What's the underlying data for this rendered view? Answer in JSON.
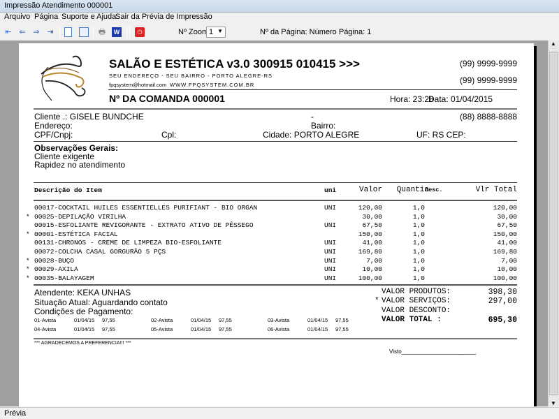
{
  "window": {
    "title": "Impressão Atendimento 000001"
  },
  "menu": [
    "Arquivo",
    "Página",
    "Suporte e Ajuda",
    "Sair da Prévia de Impressão"
  ],
  "toolbar": {
    "zoom_label": "Nº Zoom",
    "zoom_value": "1",
    "page_label": "Nº da Página: Número Página: 1",
    "icons": [
      "first-page-icon",
      "prev-page-icon",
      "next-page-icon",
      "last-page-icon",
      "single-page-icon",
      "two-page-icon",
      "print-icon",
      "word-export-icon",
      "close-preview-icon"
    ]
  },
  "report": {
    "company": "SALÃO E ESTÉTICA v3.0 300915 010415 >>>",
    "address": "SEU ENDEREÇO - SEU BAIRRO - PORTO ALEGRE-RS",
    "email": "fpqsystem@hotmail.com",
    "site": "WWW.FPQSYSTEM.COM.BR",
    "phone1": "(99) 9999-9999",
    "phone2": "(99) 9999-9999",
    "order": "Nº DA COMANDA 000001",
    "hora": "Hora: 23:28",
    "data": "Data: 01/04/2015",
    "cliente": "Cliente   .: GISELE BUNDCHE",
    "dash": "-",
    "cliente_phone": "(88) 8888-8888",
    "endereco": "Endereço:",
    "bairro": "Bairro:",
    "cpf": "CPF/Cnpj:",
    "cpl": "Cpl:",
    "cidade": "Cidade: PORTO ALEGRE",
    "uf": "UF: RS  CEP:",
    "obs_title": "Observações Gerais:",
    "obs1": "Cliente exigente",
    "obs2": "Rapidez no atendimento",
    "columns": {
      "desc": "Descrição do Item",
      "uni": "uni",
      "valor": "Valor",
      "quantia": "Quantia",
      "descv": "Desc.",
      "total": "Vlr Total"
    },
    "items": [
      {
        "star": "",
        "desc": "00017-COCKTAIL HUILES ESSENTIELLES PURIFIANT - BIO ORGAN",
        "uni": "UNI",
        "valor": "120,00",
        "qtd": "1,0",
        "total": "120,00"
      },
      {
        "star": "*",
        "desc": "00025-DEPILAÇÃO VIRILHA",
        "uni": "",
        "valor": "30,00",
        "qtd": "1,0",
        "total": "30,00"
      },
      {
        "star": "",
        "desc": "00015-ESFOLIANTE REVIGORANTE - EXTRATO ATIVO DE PÊSSEGO",
        "uni": "UNI",
        "valor": "67,50",
        "qtd": "1,0",
        "total": "67,50"
      },
      {
        "star": "*",
        "desc": "00001-ESTÉTICA FACIAL",
        "uni": "",
        "valor": "150,00",
        "qtd": "1,0",
        "total": "150,00"
      },
      {
        "star": "",
        "desc": "00131-CHRONOS - CREME DE LIMPEZA BIO-ESFOLIANTE",
        "uni": "UNI",
        "valor": "41,00",
        "qtd": "1,0",
        "total": "41,00"
      },
      {
        "star": "",
        "desc": "00072-COLCHA CASAL GORGURÃO 5 PÇS",
        "uni": "UNI",
        "valor": "169,80",
        "qtd": "1,0",
        "total": "169,80"
      },
      {
        "star": "*",
        "desc": "00028-BUÇO",
        "uni": "UNI",
        "valor": "7,00",
        "qtd": "1,0",
        "total": "7,00"
      },
      {
        "star": "*",
        "desc": "00029-AXILA",
        "uni": "UNI",
        "valor": "10,00",
        "qtd": "1,0",
        "total": "10,00"
      },
      {
        "star": "*",
        "desc": "00035-BALAYAGEM",
        "uni": "UNI",
        "valor": "100,00",
        "qtd": "1,0",
        "total": "100,00"
      }
    ],
    "atendente": "Atendente: KEKA UNHAS",
    "situacao": "Situação Atual: Aguardando contato",
    "condicoes": "Condições de Pagamento:",
    "payments": [
      {
        "n": "01-Avista",
        "d": "01/04/15",
        "v": "97,55"
      },
      {
        "n": "02-Avista",
        "d": "01/04/15",
        "v": "97,55"
      },
      {
        "n": "03-Avista",
        "d": "01/04/15",
        "v": "97,55"
      },
      {
        "n": "04-Avista",
        "d": "01/04/15",
        "v": "97,55"
      },
      {
        "n": "05-Avista",
        "d": "01/04/15",
        "v": "97,55"
      },
      {
        "n": "06-Avista",
        "d": "01/04/15",
        "v": "97,55"
      }
    ],
    "totals": [
      {
        "star": "",
        "label": "VALOR PRODUTOS:",
        "value": "398,30"
      },
      {
        "star": "*",
        "label": "VALOR SERVIÇOS:",
        "value": "297,00"
      },
      {
        "star": "",
        "label": "VALOR DESCONTO:",
        "value": ""
      },
      {
        "star": "",
        "label": "VALOR TOTAL   :",
        "value": "695,30"
      }
    ],
    "thanks": "*** AGRADECEMOS A PREFERENCIA!!! ***",
    "visto": "Visto________________________"
  },
  "status": "Prévia"
}
